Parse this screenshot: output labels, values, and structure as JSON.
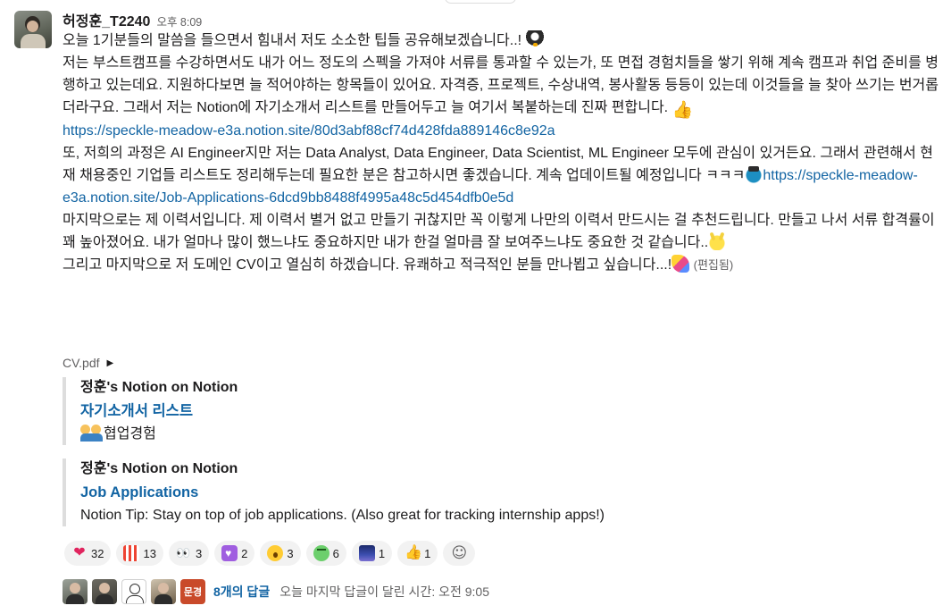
{
  "message": {
    "username": "허정훈_T2240",
    "timestamp": "오후 8:09",
    "lines": {
      "l1": "오늘 1기분들의 말씀을 들으면서 힘내서 저도 소소한 팁들 공유해보겠습니다..! ",
      "l2": "저는 부스트캠프를 수강하면서도 내가 어느 정도의 스펙을 가져야 서류를 통과할 수 있는가, 또 면접 경험치들을 쌓기 위해 계속 캠프과 취업 준비를 병행하고 있는데요. 지원하다보면 늘 적어야하는 항목들이 있어요. 자격증, 프로젝트, 수상내역, 봉사활동 등등이 있는데 이것들을 늘 찾아 쓰기는 번거롭더라구요. 그래서 저는 Notion에 자기소개서 리스트를 만들어두고 늘 여기서 복붙하는데 진짜 편합니다. ",
      "link1": "https://speckle-meadow-e3a.notion.site/80d3abf88cf74d428fda889146c8e92a",
      "l3": "또, 저희의 과정은 AI Engineer지만 저는 Data Analyst, Data Engineer, Data Scientist, ML Engineer 모두에 관심이 있거든요. 그래서 관련해서 현재 채용중인 기업들 리스트도 정리해두는데 필요한 분은 참고하시면 좋겠습니다.  계속 업데이트될 예정입니다 ㅋㅋㅋ",
      "link2": "https://speckle-meadow-e3a.notion.site/Job-Applications-6dcd9bb8488f4995a48c5d454dfb0e5d",
      "l4": "마지막으로는 제 이력서입니다. 제 이력서 별거 없고 만들기 귀찮지만 꼭 이렇게 나만의 이력서 만드시는 걸 추천드립니다. 만들고 나서 서류 합격률이 꽤 높아졌어요. 내가 얼마나 많이 했느냐도 중요하지만 내가 한걸 얼마큼 잘 보여주느냐도 중요한 것 같습니다..",
      "l5": "그리고 마지막으로 저 도메인 CV이고 열심히 하겠습니다. 유쾌하고 적극적인 분들 만나뵙고 싶습니다...!",
      "edited": "(편집됨)"
    },
    "file_name": "CV.pdf",
    "unfurls": [
      {
        "site": "정훈's Notion on Notion",
        "title": "자기소개서 리스트",
        "desc": "협업경험"
      },
      {
        "site": "정훈's Notion on Notion",
        "title": "Job Applications",
        "desc": "Notion Tip: Stay on top of job applications. (Also great for tracking internship apps!)"
      }
    ],
    "reactions": [
      {
        "icon": "red-heart",
        "count": "32"
      },
      {
        "icon": "qr-code",
        "count": "13"
      },
      {
        "icon": "eyes",
        "count": "3"
      },
      {
        "icon": "purple-heart",
        "count": "2"
      },
      {
        "icon": "hushed-face",
        "count": "3"
      },
      {
        "icon": "frog",
        "count": "6"
      },
      {
        "icon": "night-sky",
        "count": "1"
      },
      {
        "icon": "thumbs-up",
        "count": "1"
      }
    ],
    "thread": {
      "avatar_label": "문경",
      "reply_count": "8개의 답글",
      "last_reply": "오늘 마지막 답글이 달린 시간: 오전 9:05"
    }
  },
  "colors": {
    "link": "#1264a3",
    "text": "#1d1c1d",
    "muted": "#616061",
    "reaction_bg": "#f2f2f2",
    "unfurl_border": "#dddddd"
  }
}
